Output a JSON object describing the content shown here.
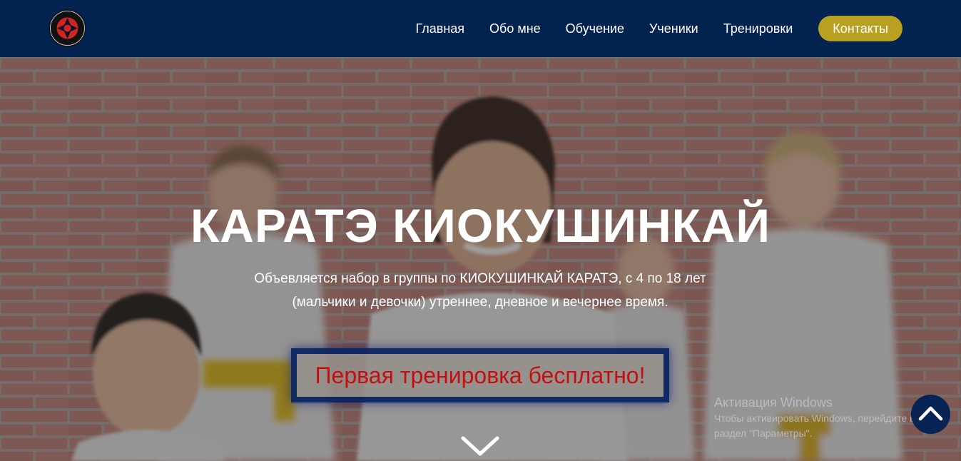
{
  "header": {
    "logo_icon": "kyokushin-kanku-logo-icon",
    "nav": [
      {
        "label": "Главная"
      },
      {
        "label": "Обо мне"
      },
      {
        "label": "Обучение"
      },
      {
        "label": "Ученики"
      },
      {
        "label": "Тренировки"
      }
    ],
    "cta_label": "Контакты"
  },
  "hero": {
    "title": "КАРАТЭ КИОКУШИНКАЙ",
    "text_line1": "Объевляется набор в группы по КИОКУШИНКАЙ КАРАТЭ, с 4 по 18 лет",
    "text_line2": "(мальчики и девочки) утреннее, дневное и вечернее время.",
    "promo": "Первая тренировка бесплатно!",
    "scroll_icon": "chevron-down-icon"
  },
  "watermark": {
    "title": "Активация Windows",
    "line1": "Чтобы активировать Windows, перейдите в",
    "line2": "раздел \"Параметры\"."
  },
  "scroll_top_icon": "chevron-up-icon",
  "colors": {
    "header_bg": "#02224f",
    "cta_bg": "#b8a121",
    "promo_text": "#c40f0f",
    "promo_border": "#06225f",
    "to_top_bg": "#082454"
  }
}
